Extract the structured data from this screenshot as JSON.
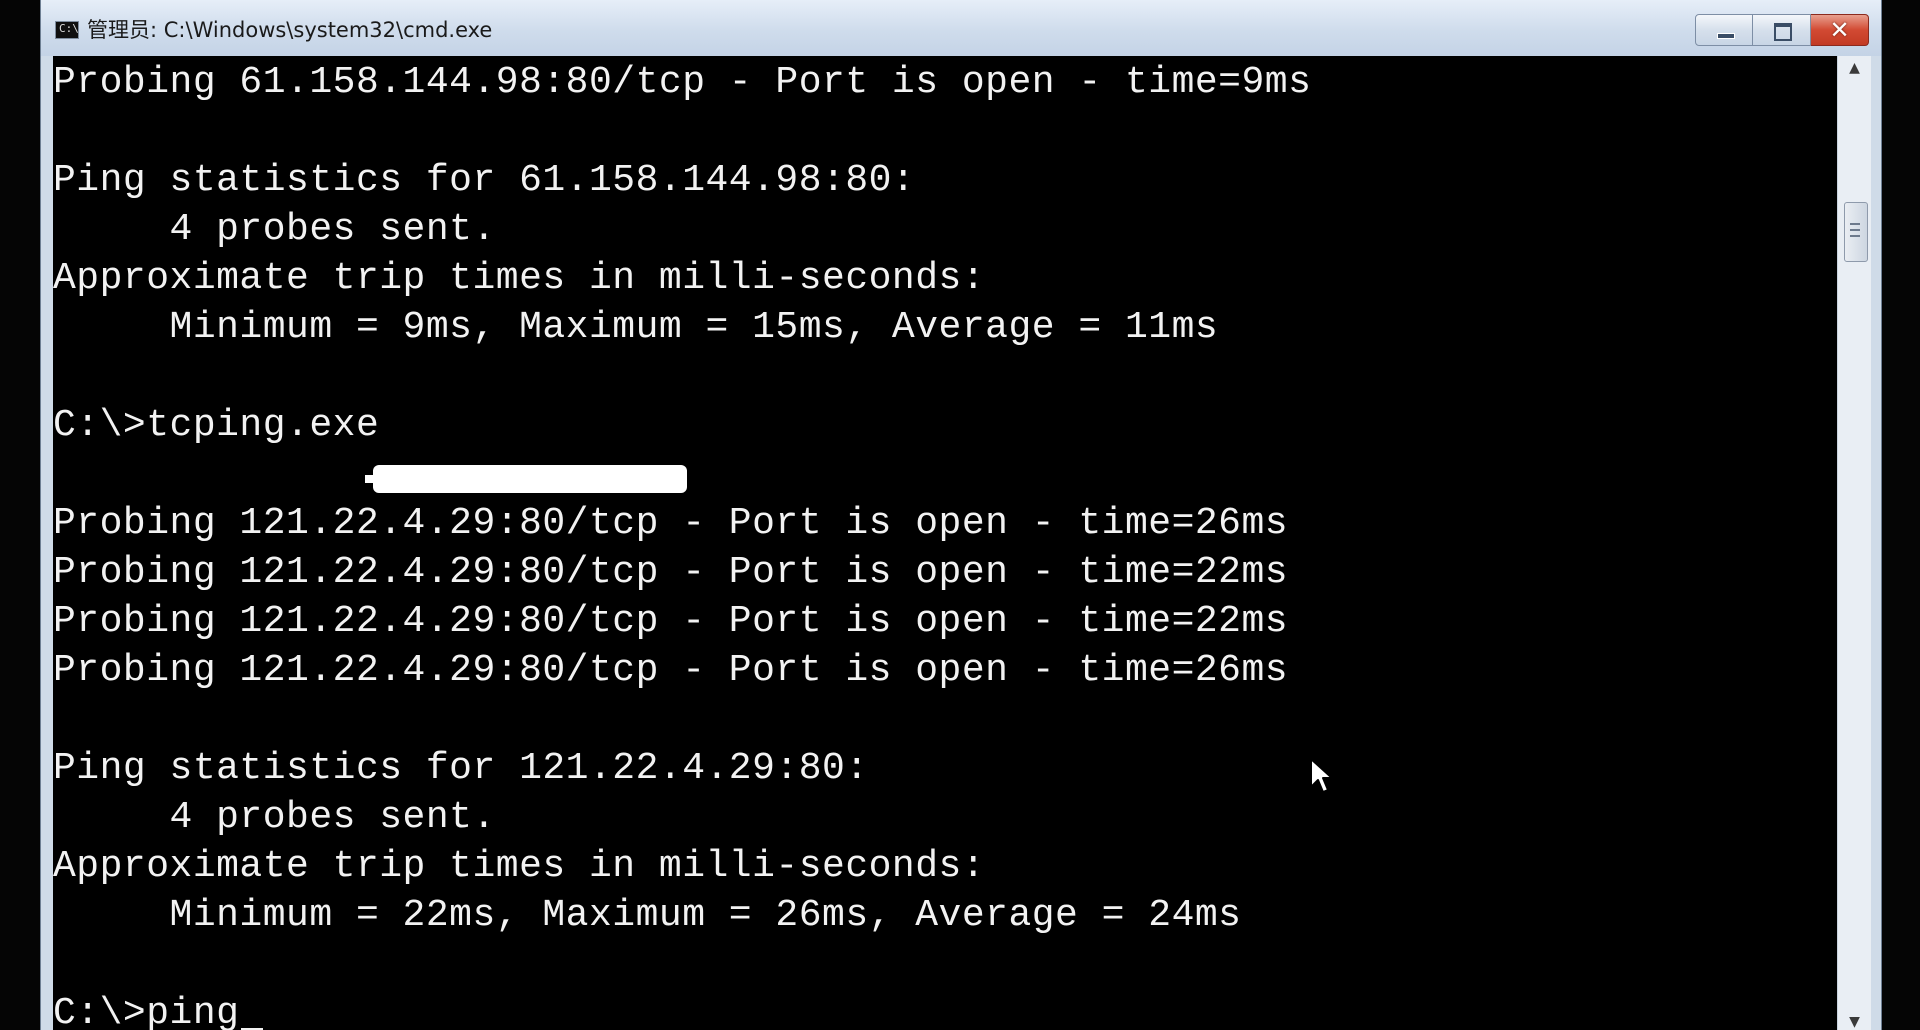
{
  "window": {
    "title": "管理员: C:\\Windows\\system32\\cmd.exe",
    "icon": "cmd-icon",
    "buttons": {
      "minimize": "minimize-icon",
      "maximize": "maximize-icon",
      "close": "close-icon"
    }
  },
  "console": {
    "lines": [
      "Probing 61.158.144.98:80/tcp - Port is open - time=9ms",
      "",
      "Ping statistics for 61.158.144.98:80:",
      "     4 probes sent.",
      "Approximate trip times in milli-seconds:",
      "     Minimum = 9ms, Maximum = 15ms, Average = 11ms",
      "",
      "C:\\>tcping.exe",
      "",
      "Probing 121.22.4.29:80/tcp - Port is open - time=26ms",
      "Probing 121.22.4.29:80/tcp - Port is open - time=22ms",
      "Probing 121.22.4.29:80/tcp - Port is open - time=22ms",
      "Probing 121.22.4.29:80/tcp - Port is open - time=26ms",
      "",
      "Ping statistics for 121.22.4.29:80:",
      "     4 probes sent.",
      "Approximate trip times in milli-seconds:",
      "     Minimum = 22ms, Maximum = 26ms, Average = 24ms",
      "",
      "C:\\>ping"
    ]
  },
  "colors": {
    "console_bg": "#000000",
    "console_fg": "#f2f2f2",
    "title_bar": "#cfdcec",
    "close_button": "#d24a33"
  },
  "icons": {
    "scroll_up": "▲",
    "scroll_down": "▼"
  }
}
